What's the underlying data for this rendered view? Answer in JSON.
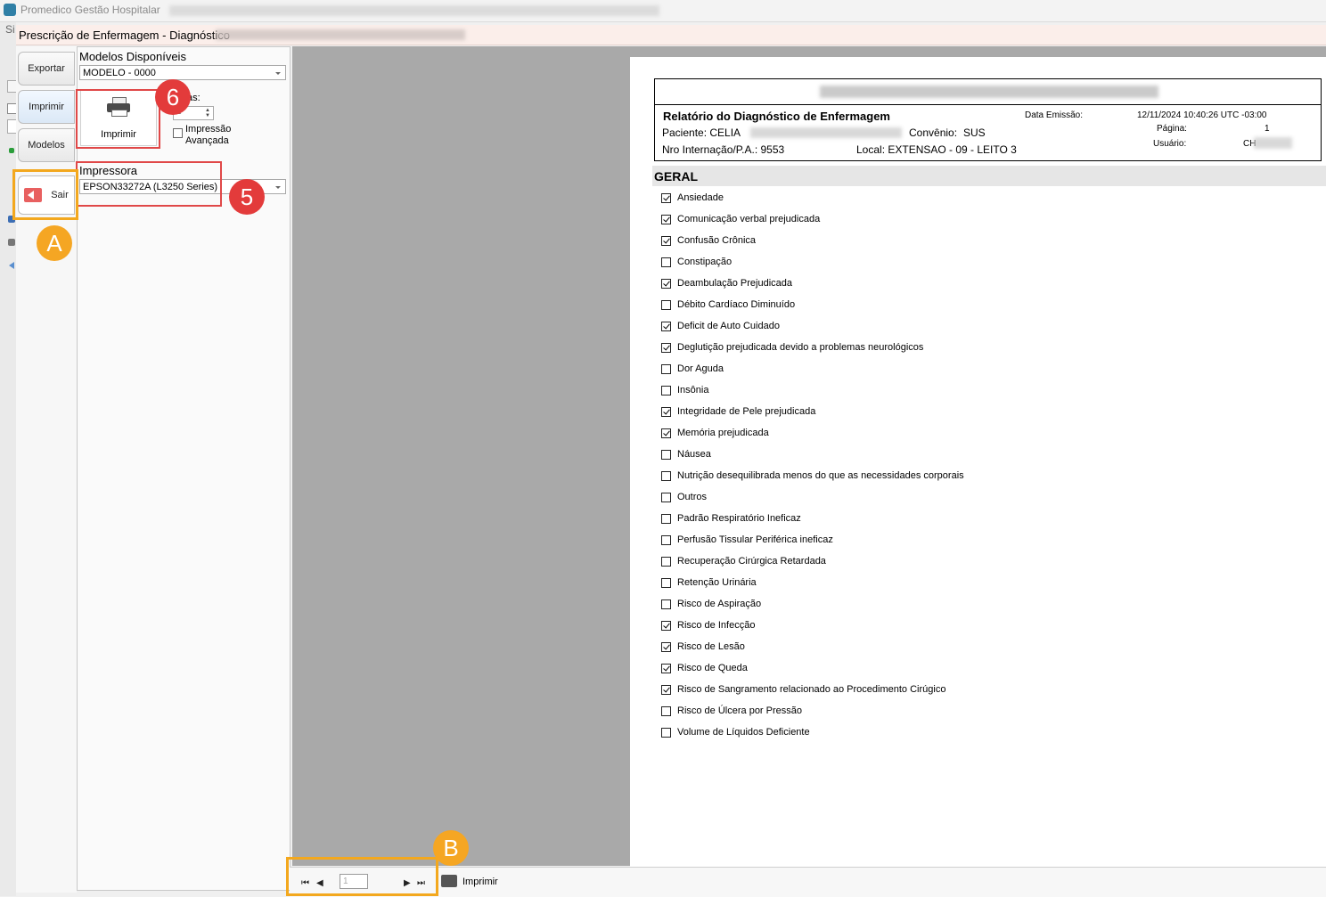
{
  "app": {
    "title": "Promedico Gestão Hospitalar",
    "menu_partial": "Si"
  },
  "dialog": {
    "title": "Prescrição de Enfermagem - Diagnóstico"
  },
  "side_tabs": [
    {
      "label": "Exportar"
    },
    {
      "label": "Imprimir"
    },
    {
      "label": "Modelos"
    },
    {
      "label": "Sair"
    }
  ],
  "panel": {
    "models_label": "Modelos Disponíveis",
    "model_value": "MODELO - 0000",
    "print_button": "Imprimir",
    "copies_label": "as:",
    "copies_value": "1",
    "advanced_print": "Impressão Avançada",
    "printer_label": "Impressora",
    "printer_value": "EPSON33272A (L3250 Series)"
  },
  "annotations": {
    "badge_6": "6",
    "badge_5": "5",
    "badge_a": "A",
    "badge_b": "B"
  },
  "report": {
    "title": "Relatório do Diagnóstico de Enfermagem",
    "emission_label": "Data Emissão:",
    "emission_value": "12/11/2024 10:40:26 UTC -03:00",
    "page_label": "Página:",
    "page_value": "1",
    "user_label": "Usuário:",
    "user_value": "CH",
    "patient_label": "Paciente: CELIA",
    "insurance_label": "Convênio:",
    "insurance_value": "SUS",
    "admission": "Nro Internação/P.A.: 9553",
    "location": "Local: EXTENSAO - 09 - LEITO 3",
    "section": "GERAL",
    "items": [
      {
        "label": "Ansiedade",
        "checked": true
      },
      {
        "label": "Comunicação verbal prejudicada",
        "checked": true
      },
      {
        "label": "Confusão Crônica",
        "checked": true
      },
      {
        "label": "Constipação",
        "checked": false
      },
      {
        "label": "Deambulação Prejudicada",
        "checked": true
      },
      {
        "label": "Débito Cardíaco Diminuído",
        "checked": false
      },
      {
        "label": "Deficit de Auto Cuidado",
        "checked": true
      },
      {
        "label": "Deglutição prejudicada devido a problemas neurológicos",
        "checked": true
      },
      {
        "label": "Dor Aguda",
        "checked": false
      },
      {
        "label": "Insônia",
        "checked": false
      },
      {
        "label": "Integridade de Pele prejudicada",
        "checked": true
      },
      {
        "label": "Memória prejudicada",
        "checked": true
      },
      {
        "label": "Náusea",
        "checked": false
      },
      {
        "label": "Nutrição desequilibrada menos do que as necessidades corporais",
        "checked": false
      },
      {
        "label": "Outros",
        "checked": false
      },
      {
        "label": "Padrão Respiratório Ineficaz",
        "checked": false
      },
      {
        "label": "Perfusão Tissular Periférica ineficaz",
        "checked": false
      },
      {
        "label": "Recuperação Cirúrgica Retardada",
        "checked": false
      },
      {
        "label": "Retenção Urinária",
        "checked": false
      },
      {
        "label": "Risco de Aspiração",
        "checked": false
      },
      {
        "label": "Risco de Infecção",
        "checked": true
      },
      {
        "label": "Risco de Lesão",
        "checked": true
      },
      {
        "label": "Risco de Queda",
        "checked": true
      },
      {
        "label": "Risco de Sangramento relacionado ao Procedimento Cirúgico",
        "checked": true
      },
      {
        "label": "Risco de Úlcera por Pressão",
        "checked": false
      },
      {
        "label": "Volume de Líquidos Deficiente",
        "checked": false
      }
    ]
  },
  "footer": {
    "page_input": "1",
    "print_label": "Imprimir"
  }
}
